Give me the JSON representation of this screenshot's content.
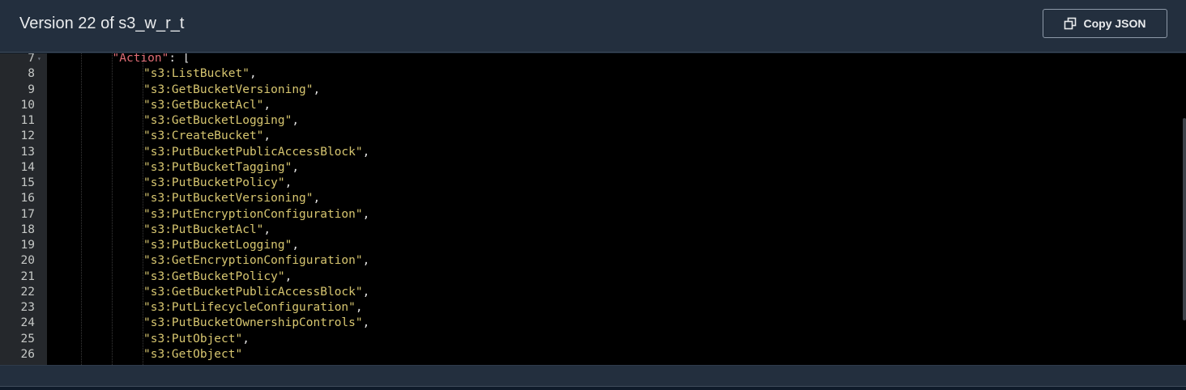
{
  "header": {
    "title": "Version 22 of s3_w_r_t",
    "copy_label": "Copy JSON",
    "copy_icon": "copy-icon"
  },
  "editor": {
    "lines": [
      {
        "num": "7",
        "indent": 2,
        "key": "\"Action\"",
        "rest": ": ["
      },
      {
        "num": "8",
        "indent": 3,
        "str": "\"s3:ListBucket\"",
        "rest": ","
      },
      {
        "num": "9",
        "indent": 3,
        "str": "\"s3:GetBucketVersioning\"",
        "rest": ","
      },
      {
        "num": "10",
        "indent": 3,
        "str": "\"s3:GetBucketAcl\"",
        "rest": ","
      },
      {
        "num": "11",
        "indent": 3,
        "str": "\"s3:GetBucketLogging\"",
        "rest": ","
      },
      {
        "num": "12",
        "indent": 3,
        "str": "\"s3:CreateBucket\"",
        "rest": ","
      },
      {
        "num": "13",
        "indent": 3,
        "str": "\"s3:PutBucketPublicAccessBlock\"",
        "rest": ","
      },
      {
        "num": "14",
        "indent": 3,
        "str": "\"s3:PutBucketTagging\"",
        "rest": ","
      },
      {
        "num": "15",
        "indent": 3,
        "str": "\"s3:PutBucketPolicy\"",
        "rest": ","
      },
      {
        "num": "16",
        "indent": 3,
        "str": "\"s3:PutBucketVersioning\"",
        "rest": ","
      },
      {
        "num": "17",
        "indent": 3,
        "str": "\"s3:PutEncryptionConfiguration\"",
        "rest": ","
      },
      {
        "num": "18",
        "indent": 3,
        "str": "\"s3:PutBucketAcl\"",
        "rest": ","
      },
      {
        "num": "19",
        "indent": 3,
        "str": "\"s3:PutBucketLogging\"",
        "rest": ","
      },
      {
        "num": "20",
        "indent": 3,
        "str": "\"s3:GetEncryptionConfiguration\"",
        "rest": ","
      },
      {
        "num": "21",
        "indent": 3,
        "str": "\"s3:GetBucketPolicy\"",
        "rest": ","
      },
      {
        "num": "22",
        "indent": 3,
        "str": "\"s3:GetBucketPublicAccessBlock\"",
        "rest": ","
      },
      {
        "num": "23",
        "indent": 3,
        "str": "\"s3:PutLifecycleConfiguration\"",
        "rest": ","
      },
      {
        "num": "24",
        "indent": 3,
        "str": "\"s3:PutBucketOwnershipControls\"",
        "rest": ","
      },
      {
        "num": "25",
        "indent": 3,
        "str": "\"s3:PutObject\"",
        "rest": ","
      },
      {
        "num": "26",
        "indent": 3,
        "str": "\"s3:GetObject\"",
        "rest": ""
      }
    ],
    "fold_line": "7"
  },
  "colors": {
    "header_bg": "#232f3e",
    "editor_bg": "#000000",
    "json_key": "#e06c75",
    "json_string": "#d7c670"
  }
}
